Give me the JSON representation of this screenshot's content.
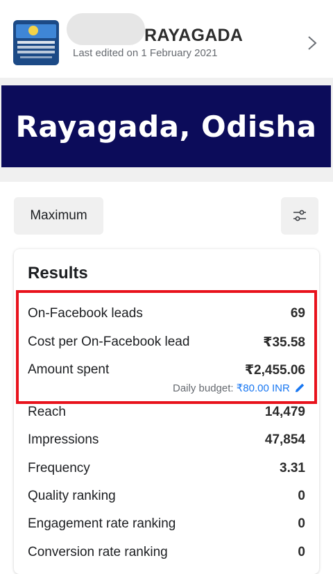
{
  "header": {
    "title": "RAYAGADA",
    "last_edited": "Last edited on 1 February 2021",
    "thumbnail_icon": "ad-thumbnail-image",
    "chevron_icon": "chevron-right-icon"
  },
  "banner": {
    "text": "Rayagada, Odisha",
    "background": "#0c0c5a"
  },
  "controls": {
    "maximum_label": "Maximum",
    "filter_icon": "filter-sliders-icon"
  },
  "results": {
    "title": "Results",
    "rows": [
      {
        "label": "On-Facebook leads",
        "value": "69"
      },
      {
        "label": "Cost per On-Facebook lead",
        "value": "₹35.58"
      },
      {
        "label": "Amount spent",
        "value": "₹2,455.06"
      },
      {
        "label": "Reach",
        "value": "14,479"
      },
      {
        "label": "Impressions",
        "value": "47,854"
      },
      {
        "label": "Frequency",
        "value": "3.31"
      },
      {
        "label": "Quality ranking",
        "value": "0"
      },
      {
        "label": "Engagement rate ranking",
        "value": "0"
      },
      {
        "label": "Conversion rate ranking",
        "value": "0"
      }
    ],
    "daily_budget_label": "Daily budget:",
    "daily_budget_value": "₹80.00 INR",
    "edit_icon": "pencil-edit-icon"
  },
  "colors": {
    "highlight_border": "#e8121c",
    "link_blue": "#1877f2"
  }
}
